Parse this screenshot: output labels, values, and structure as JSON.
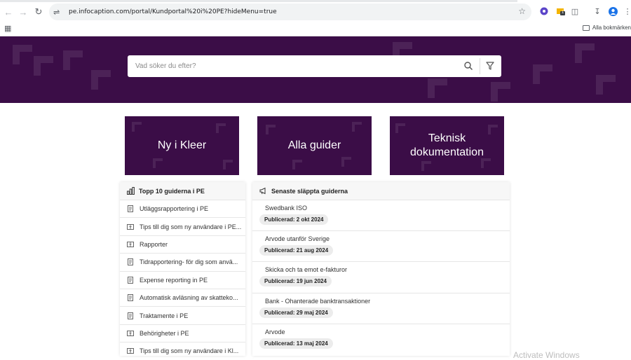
{
  "browser": {
    "url": "pe.infocaption.com/portal/Kundportal%20i%20PE?hideMenu=true",
    "all_bookmarks": "Alla bokmärken",
    "extension_badge": "1"
  },
  "search": {
    "placeholder": "Vad söker du efter?"
  },
  "tiles": [
    {
      "label": "Ny i Kleer"
    },
    {
      "label": "Alla guider"
    },
    {
      "label": "Teknisk dokumentation"
    }
  ],
  "top10": {
    "heading": "Topp 10 guiderna i PE",
    "items": [
      {
        "label": "Utläggsrapportering i PE",
        "icon": "document-icon"
      },
      {
        "label": "Tips till dig som ny användare i PE...",
        "icon": "book-icon"
      },
      {
        "label": "Rapporter",
        "icon": "book-icon"
      },
      {
        "label": "Tidrapportering- för dig som anvä...",
        "icon": "document-icon"
      },
      {
        "label": "Expense reporting in PE",
        "icon": "document-icon"
      },
      {
        "label": "Automatisk avläsning av skatteko...",
        "icon": "document-icon"
      },
      {
        "label": "Traktamente i PE",
        "icon": "document-icon"
      },
      {
        "label": "Behörigheter i PE",
        "icon": "book-icon"
      },
      {
        "label": "Tips till dig som ny användare i Kl...",
        "icon": "book-icon"
      }
    ]
  },
  "latest": {
    "heading": "Senaste släppta guiderna",
    "items": [
      {
        "label": "Swedbank ISO",
        "published": "Publicerad: 2 okt 2024"
      },
      {
        "label": "Arvode utanför Sverige",
        "published": "Publicerad: 21 aug 2024"
      },
      {
        "label": "Skicka och ta emot e-fakturor",
        "published": "Publicerad: 19 jun 2024"
      },
      {
        "label": "Bank - Ohanterade banktransaktioner",
        "published": "Publicerad: 29 maj 2024"
      },
      {
        "label": "Arvode",
        "published": "Publicerad: 13 maj 2024"
      }
    ]
  },
  "watermark": "Activate Windows",
  "colors": {
    "brand": "#3b0d47",
    "badge_bg": "#ececec"
  }
}
